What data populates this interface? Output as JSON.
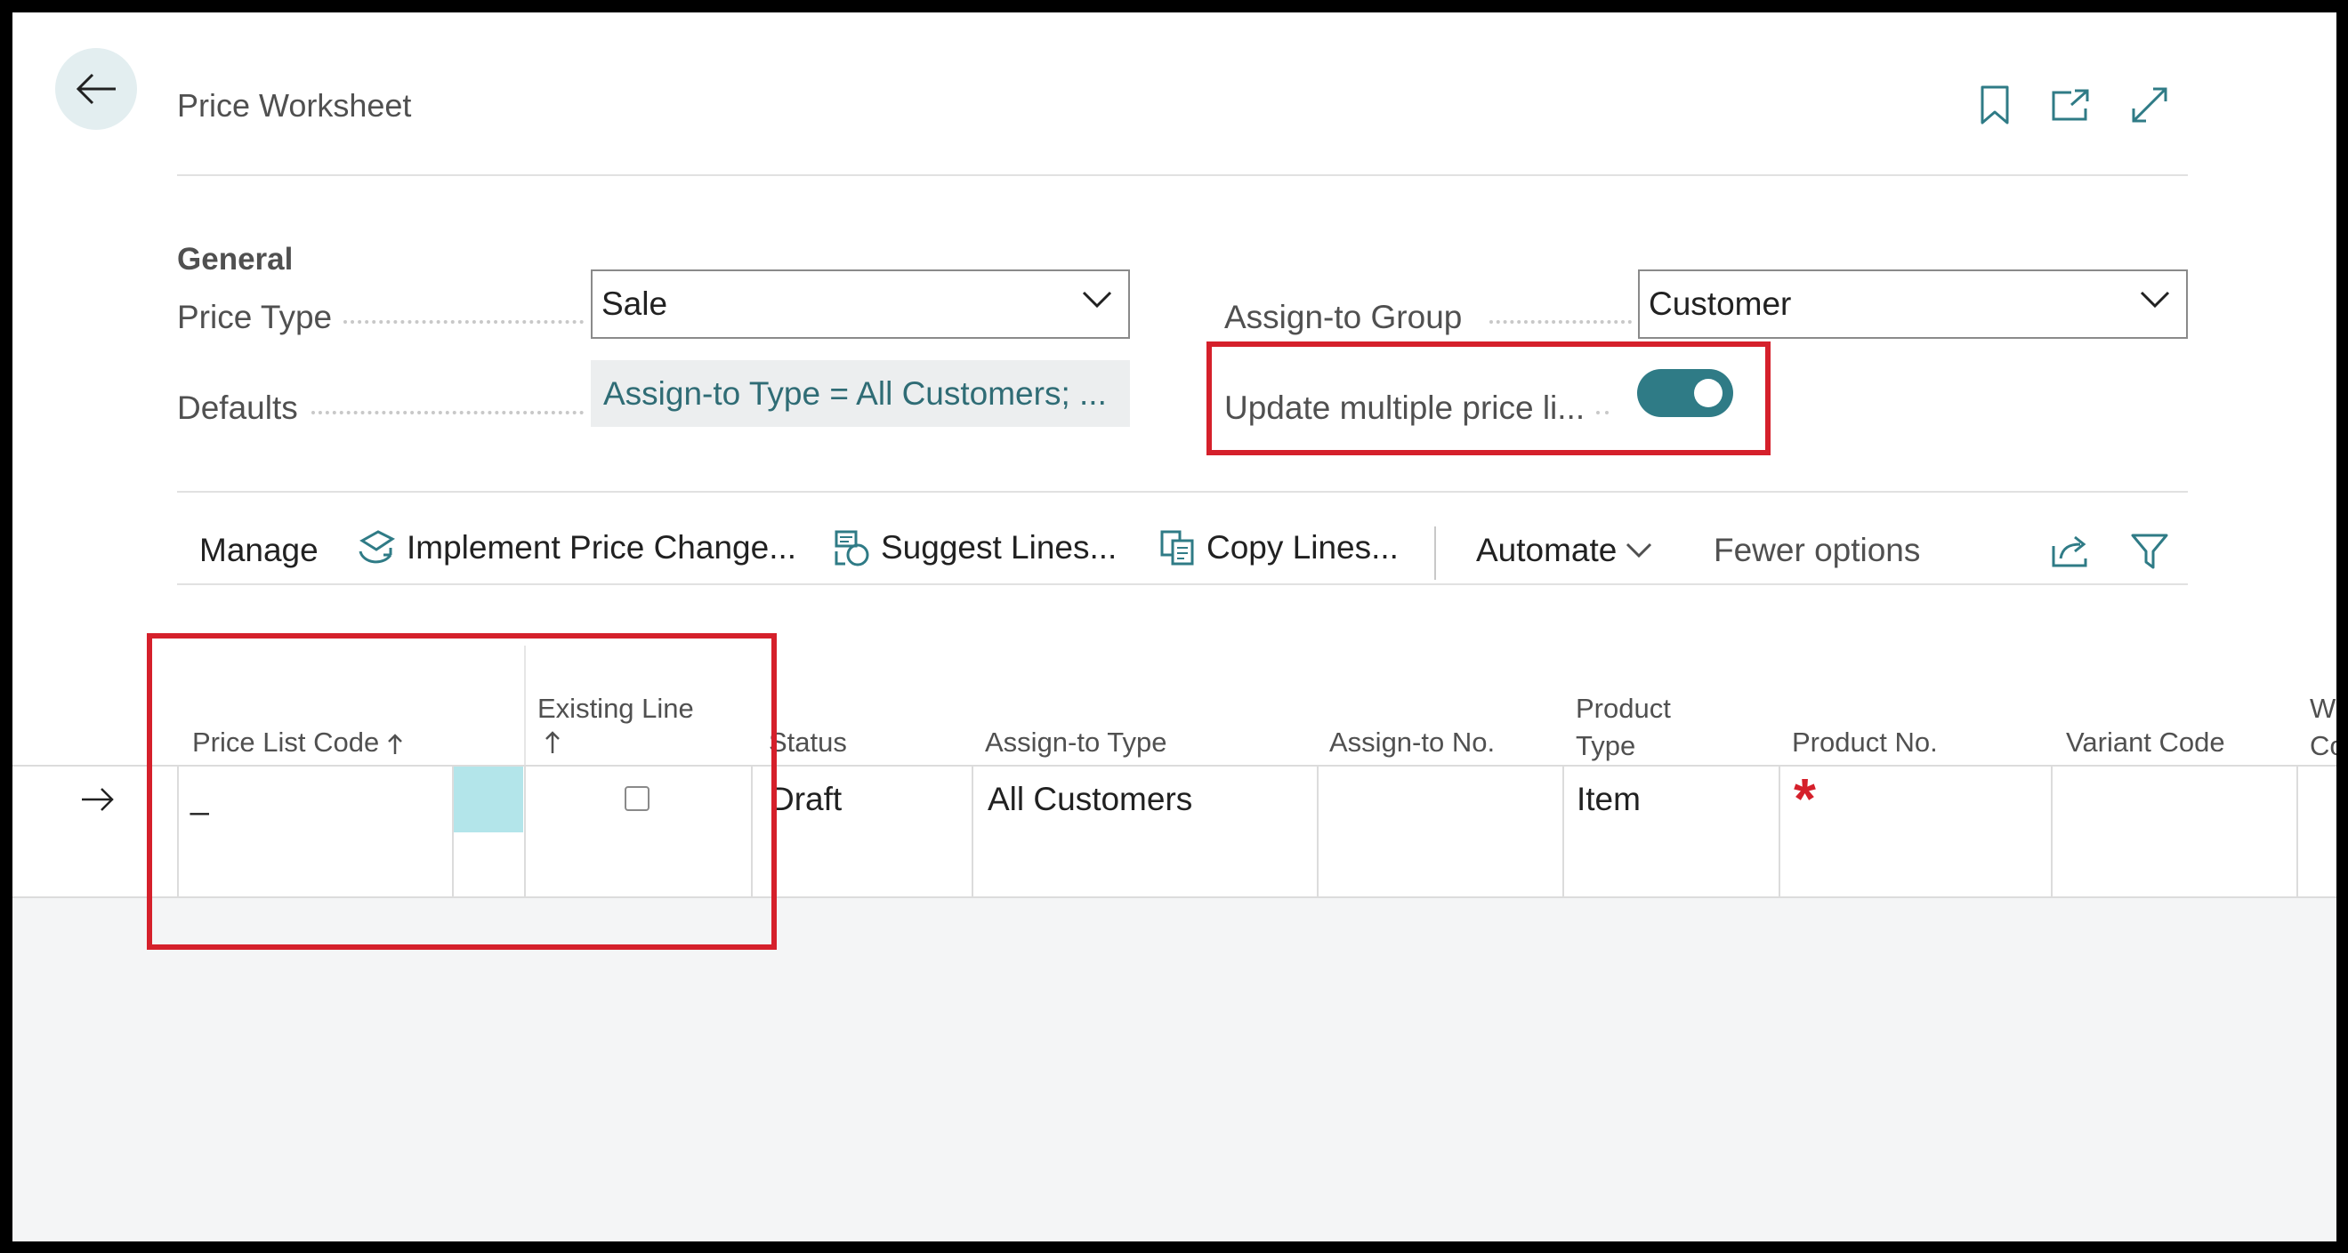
{
  "page": {
    "title": "Price Worksheet"
  },
  "general": {
    "section_title": "General",
    "price_type": {
      "label": "Price Type",
      "value": "Sale"
    },
    "defaults": {
      "label": "Defaults",
      "value": "Assign-to Type = All Customers; ..."
    },
    "assign_to_group": {
      "label": "Assign-to Group",
      "value": "Customer"
    },
    "update_multiple": {
      "label": "Update multiple price li...",
      "enabled": true
    }
  },
  "actions": {
    "manage": "Manage",
    "implement": "Implement Price Change...",
    "suggest": "Suggest Lines...",
    "copy": "Copy Lines...",
    "automate": "Automate",
    "fewer": "Fewer options"
  },
  "grid": {
    "columns": {
      "price_list_code": "Price List Code",
      "existing_line": "Existing Line",
      "status": "Status",
      "assign_to_type": "Assign-to Type",
      "assign_to_no": "Assign-to No.",
      "product_type_1": "Product",
      "product_type_2": "Type",
      "product_no": "Product No.",
      "variant_code": "Variant Code",
      "next_1": "W",
      "next_2": "Co"
    },
    "rows": [
      {
        "price_list_code": "_",
        "existing_line": false,
        "status": "Draft",
        "assign_to_type": "All Customers",
        "assign_to_no": "",
        "product_type": "Item",
        "product_no": "",
        "required_marker": "*",
        "variant_code": ""
      }
    ]
  },
  "colors": {
    "accent": "#2f7b86",
    "highlight": "#d5202b",
    "required": "#d5202b",
    "link": "#2f6c75"
  }
}
